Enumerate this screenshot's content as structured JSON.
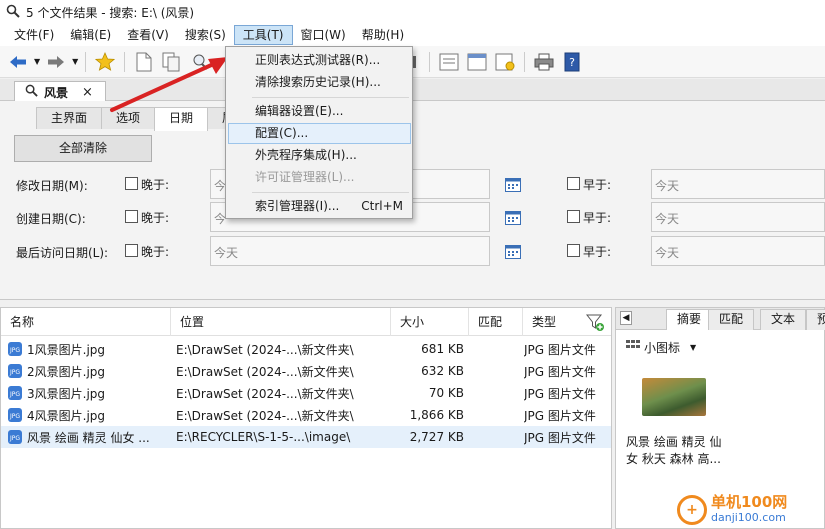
{
  "window": {
    "title": "5 个文件结果 - 搜索: E:\\ (风景)"
  },
  "menu": {
    "items": [
      "文件(F)",
      "编辑(E)",
      "查看(V)",
      "搜索(S)",
      "工具(T)",
      "窗口(W)",
      "帮助(H)"
    ],
    "active_index": 4
  },
  "search_tab": {
    "label": "风景",
    "close": "×"
  },
  "criteria": {
    "tabs": [
      "主界面",
      "选项",
      "日期",
      "属"
    ],
    "active_tab_index": 2,
    "clear_all_button": "全部清除",
    "rows": [
      {
        "label": "修改日期(M):",
        "after_label": "晚于:",
        "after_value": "今",
        "before_label": "早于:",
        "before_value": "今天"
      },
      {
        "label": "创建日期(C):",
        "after_label": "晚于:",
        "after_value": "今",
        "before_label": "早于:",
        "before_value": "今天"
      },
      {
        "label": "最后访问日期(L):",
        "after_label": "晚于:",
        "after_value": "今天",
        "before_label": "早于:",
        "before_value": "今天"
      }
    ]
  },
  "tools_menu": {
    "items": [
      {
        "label": "正则表达式测试器(R)...",
        "shortcut": ""
      },
      {
        "label": "清除搜索历史记录(H)...",
        "shortcut": ""
      },
      {
        "label": "编辑器设置(E)...",
        "shortcut": ""
      },
      {
        "label": "配置(C)...",
        "shortcut": ""
      },
      {
        "label": "外壳程序集成(H)...",
        "shortcut": ""
      },
      {
        "label": "许可证管理器(L)...",
        "shortcut": ""
      },
      {
        "label": "索引管理器(I)...",
        "shortcut": "Ctrl+M"
      }
    ],
    "highlighted_index": 3,
    "disabled_index": 5
  },
  "results": {
    "columns": [
      "名称",
      "位置",
      "大小",
      "匹配",
      "类型"
    ],
    "rows": [
      {
        "name": "1风景图片.jpg",
        "location": "E:\\DrawSet (2024-...\\新文件夹\\",
        "size": "681 KB",
        "match": "",
        "type": "JPG 图片文件"
      },
      {
        "name": "2风景图片.jpg",
        "location": "E:\\DrawSet (2024-...\\新文件夹\\",
        "size": "632 KB",
        "match": "",
        "type": "JPG 图片文件"
      },
      {
        "name": "3风景图片.jpg",
        "location": "E:\\DrawSet (2024-...\\新文件夹\\",
        "size": "70 KB",
        "match": "",
        "type": "JPG 图片文件"
      },
      {
        "name": "4风景图片.jpg",
        "location": "E:\\DrawSet (2024-...\\新文件夹\\",
        "size": "1,866 KB",
        "match": "",
        "type": "JPG 图片文件"
      },
      {
        "name": "风景 绘画 精灵 仙女 ...",
        "location": "E:\\RECYCLER\\S-1-5-...\\image\\",
        "size": "2,727 KB",
        "match": "",
        "type": "JPG 图片文件"
      }
    ],
    "selected_index": 4
  },
  "preview": {
    "tabs": [
      "摘要",
      "匹配",
      "文本",
      "预"
    ],
    "active_tab_index": 0,
    "view_mode": "小图标",
    "caption_line1": "风景 绘画 精灵 仙",
    "caption_line2": "女 秋天 森林 高..."
  },
  "watermark": {
    "name": "单机100网",
    "url": "danji100.com"
  },
  "colors": {
    "accent": "#cce4f7",
    "selection": "#e5f0fb",
    "arrow": "#d92323",
    "watermark": "#f08a1e"
  },
  "icons": [
    "search-icon",
    "back-arrow-icon",
    "forward-arrow-icon",
    "star-icon",
    "document-icon",
    "copy-icon",
    "stop-icon",
    "layout-icon",
    "print-icon",
    "help-book-icon",
    "calendar-icon",
    "jpg-file-icon",
    "filter-icon",
    "chevron-down-icon"
  ]
}
